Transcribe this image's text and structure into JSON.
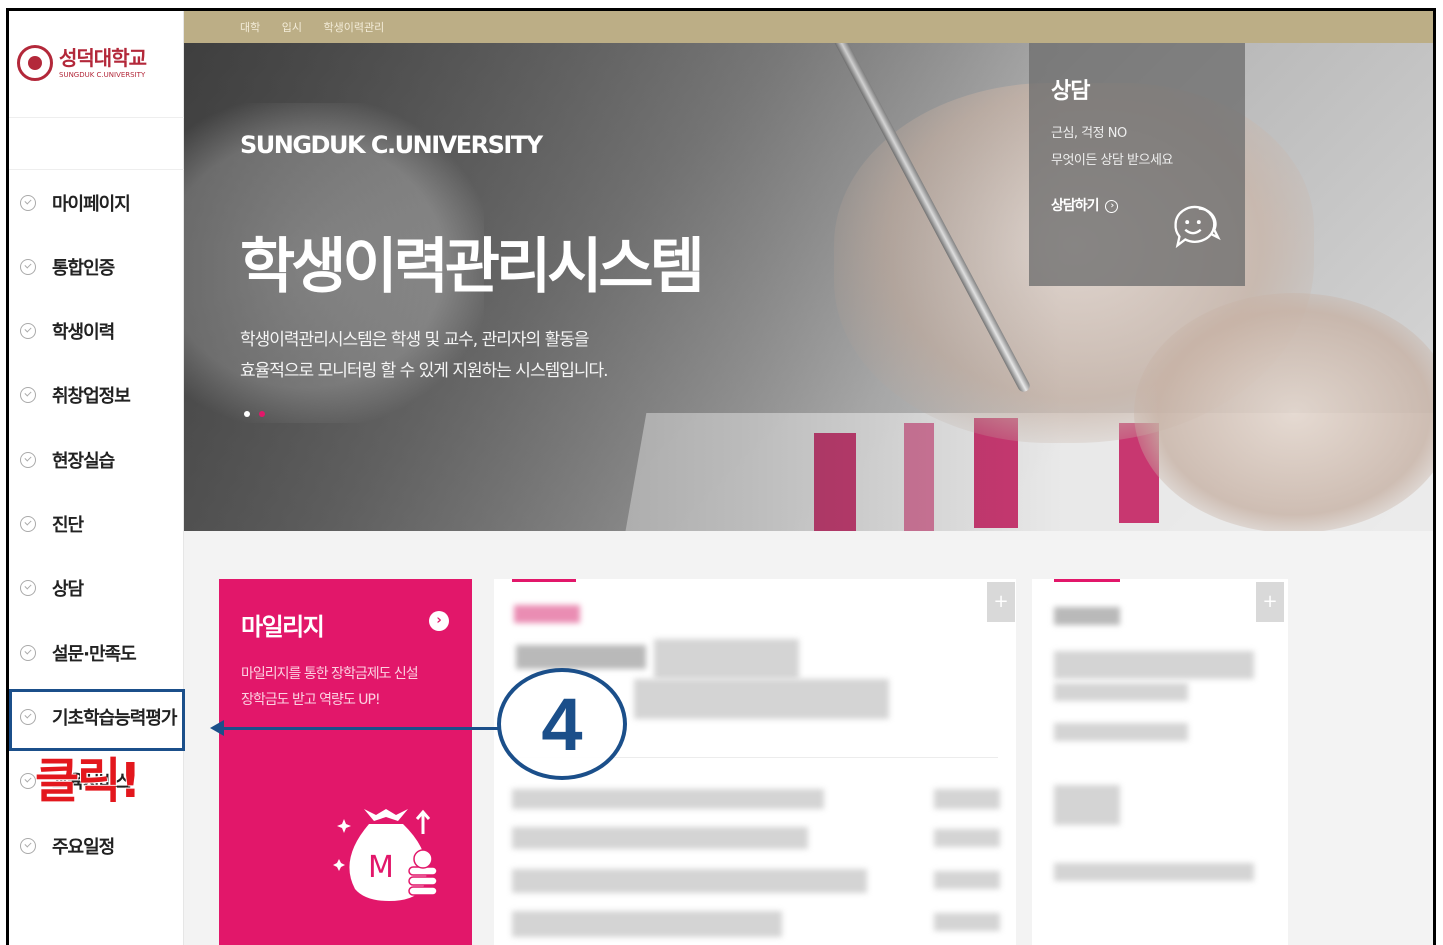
{
  "logo": {
    "kr": "성덕대학교",
    "en": "SUNGDUK C.UNIVERSITY"
  },
  "topbar": {
    "crumbs": [
      "대학",
      "입시",
      "학생이력관리"
    ]
  },
  "sidebar": {
    "items": [
      {
        "label": "마이페이지"
      },
      {
        "label": "통합인증"
      },
      {
        "label": "학생이력"
      },
      {
        "label": "취창업정보"
      },
      {
        "label": "현장실습"
      },
      {
        "label": "진단"
      },
      {
        "label": "상담"
      },
      {
        "label": "설문·만족도"
      },
      {
        "label": "기초학습능력평가"
      },
      {
        "label": "교육서비스"
      },
      {
        "label": "주요일정"
      }
    ]
  },
  "hero": {
    "brand": "SUNGDUK C.UNIVERSITY",
    "title": "학생이력관리시스템",
    "desc_line1": "학생이력관리시스템은 학생 및 교수, 관리자의 활동을",
    "desc_line2": "효율적으로 모니터링 할 수 있게 지원하는 시스템입니다."
  },
  "consult": {
    "title": "상담",
    "line1": "근심, 걱정 NO",
    "line2": "무엇이든 상담 받으세요",
    "link": "상담하기",
    "link_arrow": "›"
  },
  "mileage": {
    "title": "마일리지",
    "arrow": "›",
    "desc_line1": "마일리지를 통한 장학금제도 신설",
    "desc_line2": "장학금도 받고 역량도 UP!",
    "bag_letter": "M"
  },
  "cards": {
    "plus": "+"
  },
  "annotation": {
    "step": "4",
    "click_text": "클릭!"
  },
  "colors": {
    "brand_red": "#b3283a",
    "mileage_pink": "#e2176a",
    "topbar": "#bcae86",
    "annotation_blue": "#1b4f8a",
    "click_red": "#e3171d"
  }
}
